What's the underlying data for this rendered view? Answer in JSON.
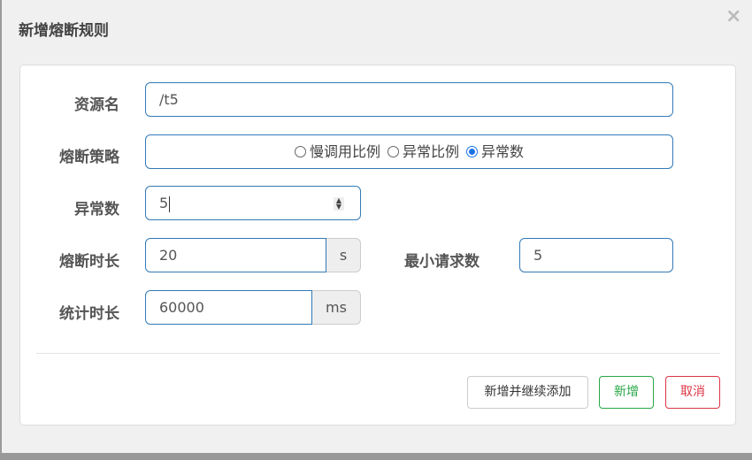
{
  "dialog": {
    "title": "新增熔断规则",
    "close_icon": "×"
  },
  "form": {
    "resource": {
      "label": "资源名",
      "value": "/t5"
    },
    "strategy": {
      "label": "熔断策略",
      "options": [
        {
          "label": "慢调用比例",
          "selected": false
        },
        {
          "label": "异常比例",
          "selected": false
        },
        {
          "label": "异常数",
          "selected": true
        }
      ]
    },
    "exception_count": {
      "label": "异常数",
      "value": "5"
    },
    "break_duration": {
      "label": "熔断时长",
      "value": "20",
      "unit": "s"
    },
    "min_request": {
      "label": "最小请求数",
      "value": "5"
    },
    "stat_duration": {
      "label": "统计时长",
      "value": "60000",
      "unit": "ms"
    }
  },
  "buttons": {
    "add_continue": "新增并继续添加",
    "add": "新增",
    "cancel": "取消"
  },
  "colors": {
    "primary": "#337ab7",
    "success": "#28a745",
    "danger": "#dc3545"
  }
}
